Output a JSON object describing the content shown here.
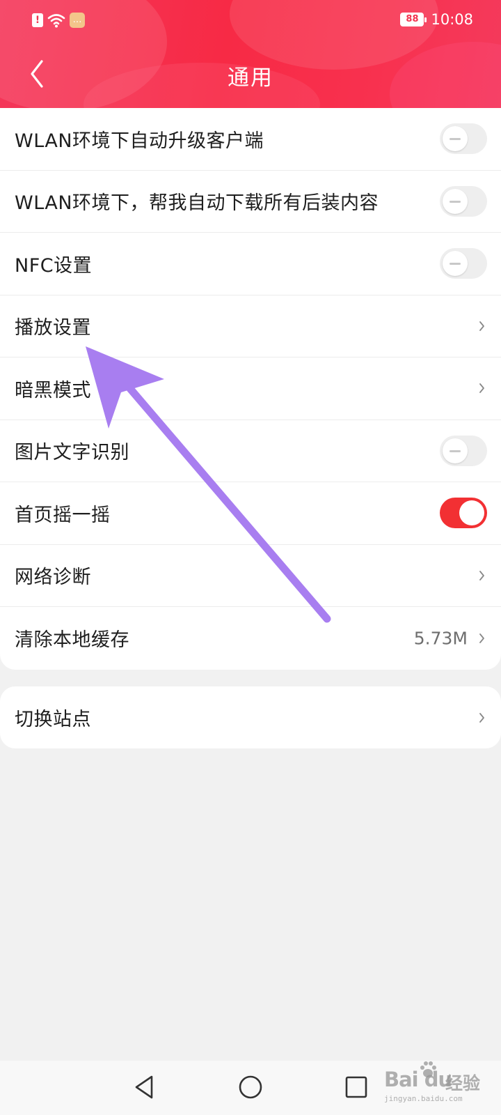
{
  "status_bar": {
    "time": "10:08",
    "battery_level": "88",
    "alert_symbol": "!",
    "message_symbol": "…"
  },
  "header": {
    "title": "通用",
    "background_color": "#f72a45"
  },
  "settings": [
    {
      "label": "WLAN环境下自动升级客户端",
      "control": "toggle",
      "enabled": false
    },
    {
      "label": "WLAN环境下，帮我自动下载所有后装内容",
      "control": "toggle",
      "enabled": false
    },
    {
      "label": "NFC设置",
      "control": "toggle",
      "enabled": false
    },
    {
      "label": "播放设置",
      "control": "chevron"
    },
    {
      "label": "暗黑模式",
      "control": "chevron"
    },
    {
      "label": "图片文字识别",
      "control": "toggle",
      "enabled": false
    },
    {
      "label": "首页摇一摇",
      "control": "toggle",
      "enabled": true
    },
    {
      "label": "网络诊断",
      "control": "chevron"
    },
    {
      "label": "清除本地缓存",
      "control": "chevron",
      "value": "5.73M"
    }
  ],
  "site_switch": {
    "label": "切换站点",
    "control": "chevron"
  },
  "colors": {
    "toggle_on": "#f23033",
    "toggle_off": "#eeeeee",
    "annotation_arrow": "#a87ef0"
  },
  "icons": {
    "back": "chevron-left-icon",
    "row_arrow": "chevron-right-icon",
    "nav_back": "triangle-back-icon",
    "nav_home": "circle-home-icon",
    "nav_recent": "square-recent-icon"
  },
  "watermark": {
    "brand": "Bai du",
    "label": "经验",
    "url": "jingyan.baidu.com"
  }
}
